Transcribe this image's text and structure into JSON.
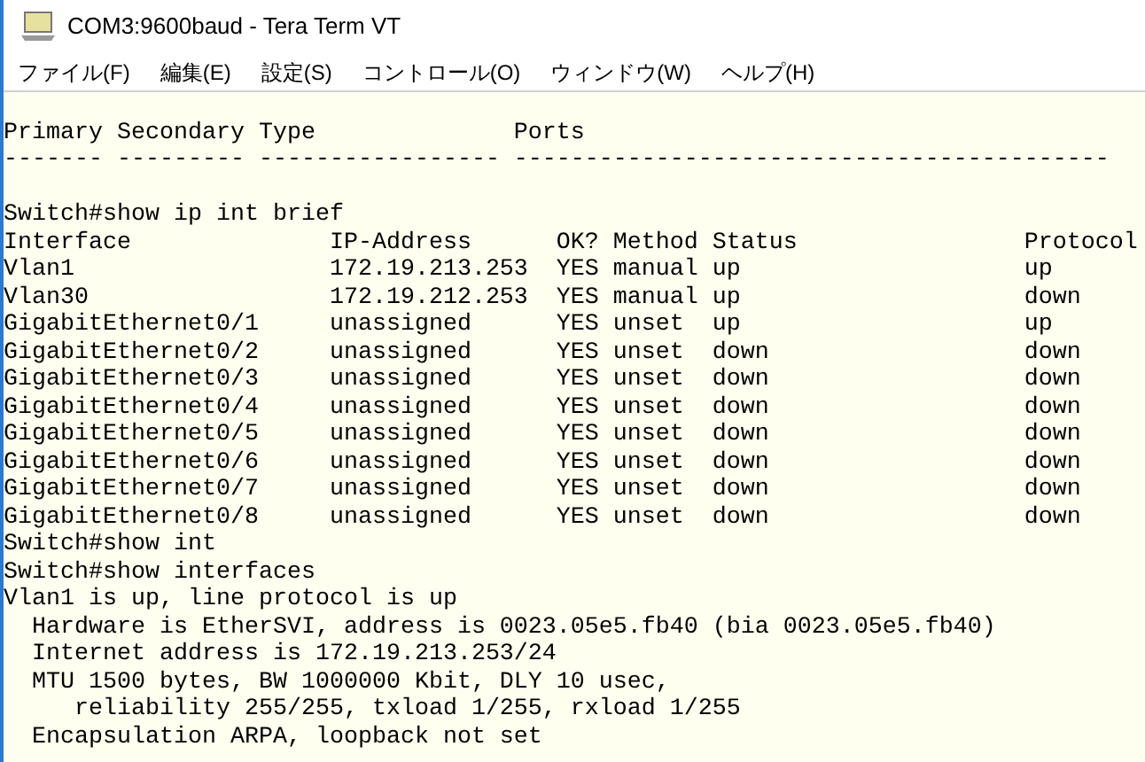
{
  "window": {
    "title": "COM3:9600baud - Tera Term VT"
  },
  "menu": [
    "ファイル(F)",
    "編集(E)",
    "設定(S)",
    "コントロール(O)",
    "ウィンドウ(W)",
    "ヘルプ(H)"
  ],
  "terminal": [
    {
      "kind": "blank"
    },
    {
      "kind": "line",
      "text": "Primary Secondary Type              Ports"
    },
    {
      "kind": "line",
      "text": "------- --------- ----------------- ------------------------------------------"
    },
    {
      "kind": "blank"
    },
    {
      "kind": "line",
      "text": "Switch#show ip int brief"
    },
    {
      "kind": "line",
      "text": "Interface              IP-Address      OK? Method Status                Protocol"
    },
    {
      "kind": "line",
      "text": "Vlan1                  172.19.213.253  YES manual up                    up"
    },
    {
      "kind": "line",
      "text": "Vlan30                 172.19.212.253  YES manual up                    down"
    },
    {
      "kind": "line",
      "text": "GigabitEthernet0/1     unassigned      YES unset  up                    up"
    },
    {
      "kind": "line",
      "text": "GigabitEthernet0/2     unassigned      YES unset  down                  down"
    },
    {
      "kind": "line",
      "text": "GigabitEthernet0/3     unassigned      YES unset  down                  down"
    },
    {
      "kind": "line",
      "text": "GigabitEthernet0/4     unassigned      YES unset  down                  down"
    },
    {
      "kind": "line",
      "text": "GigabitEthernet0/5     unassigned      YES unset  down                  down"
    },
    {
      "kind": "line",
      "text": "GigabitEthernet0/6     unassigned      YES unset  down                  down"
    },
    {
      "kind": "line",
      "text": "GigabitEthernet0/7     unassigned      YES unset  down                  down"
    },
    {
      "kind": "line",
      "text": "GigabitEthernet0/8     unassigned      YES unset  down                  down"
    },
    {
      "kind": "line",
      "text": "Switch#show int"
    },
    {
      "kind": "line",
      "text": "Switch#show interfaces"
    },
    {
      "kind": "line",
      "text": "Vlan1 is up, line protocol is up"
    },
    {
      "kind": "line",
      "text": "  Hardware is EtherSVI, address is 0023.05e5.fb40 (bia 0023.05e5.fb40)"
    },
    {
      "kind": "line",
      "text": "  Internet address is 172.19.213.253/24"
    },
    {
      "kind": "line",
      "text": "  MTU 1500 bytes, BW 1000000 Kbit, DLY 10 usec,"
    },
    {
      "kind": "line",
      "text": "     reliability 255/255, txload 1/255, rxload 1/255"
    },
    {
      "kind": "line",
      "text": "  Encapsulation ARPA, loopback not set"
    }
  ]
}
